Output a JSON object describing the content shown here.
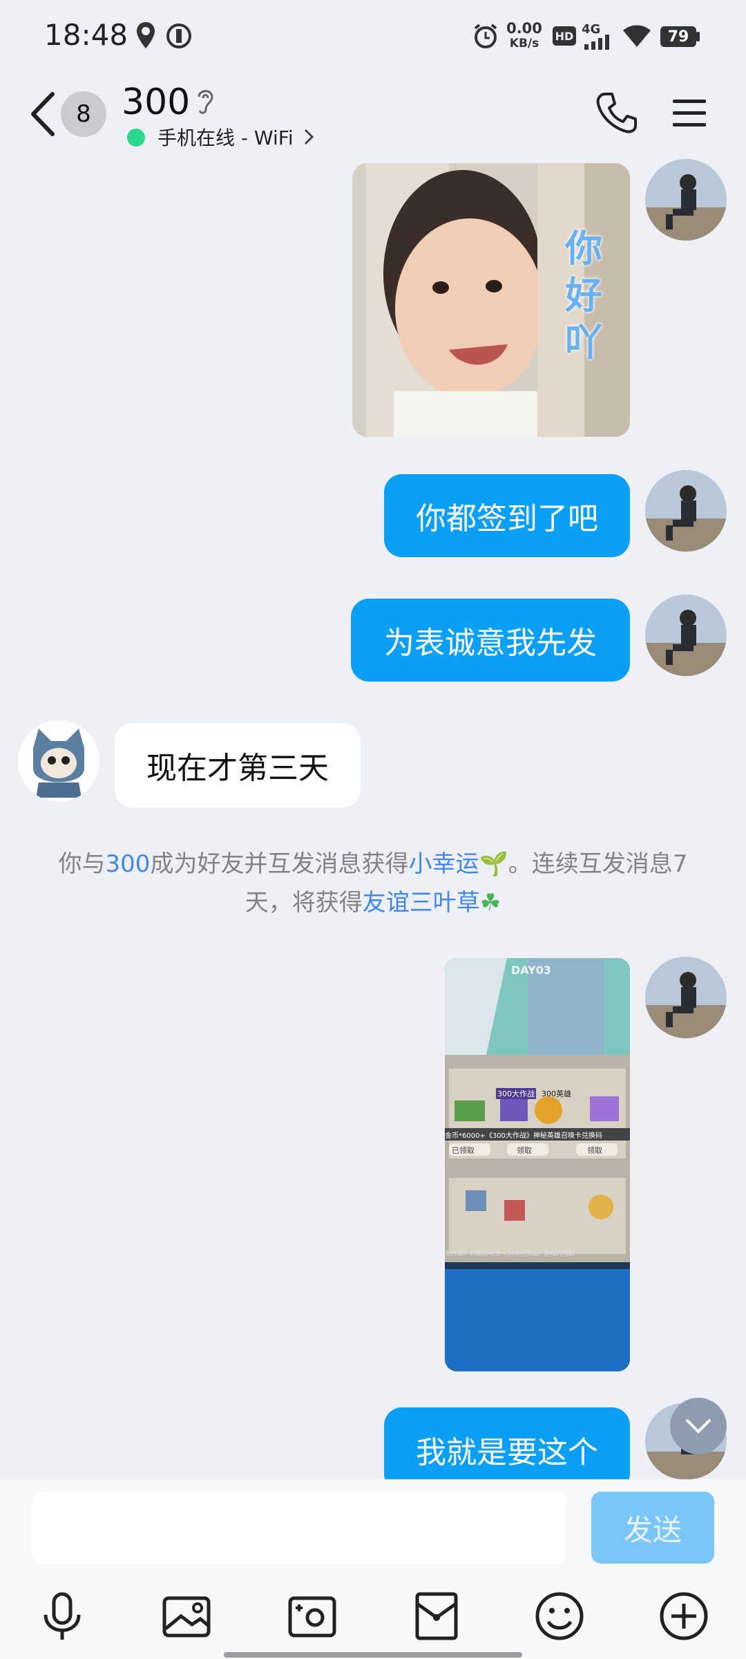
{
  "status_bar": {
    "time": "18:48",
    "net_speed_value": "0.00",
    "net_speed_unit": "KB/s",
    "hd_label": "HD",
    "signal_label": "4G",
    "battery": "79"
  },
  "header": {
    "unread_count": "8",
    "contact_name": "300",
    "online_status": "手机在线 - WiFi"
  },
  "messages": {
    "m1_sticker_text": "你好吖",
    "m2": "你都签到了吧",
    "m3": "为表诚意我先发",
    "m4": "现在才第三天",
    "m6": "我就是要这个"
  },
  "system_message": {
    "p1": "你与",
    "name": "300",
    "p2": "成为好友并互发消息获得",
    "link1": "小幸运",
    "p3": "。连续互发消息7天，将获得",
    "link2": "友谊三叶草"
  },
  "screenshot_texts": {
    "title1": "300大作战",
    "title2": "300英雄",
    "reward_line": "金币*6000+《300大作战》神秘英雄召唤卡兑换码",
    "btn_claimed": "已领取",
    "btn_claim": "领取",
    "btn_claim2": "领取",
    "footer": "大作战》的奖励可至《300大作战》游戏内领取~",
    "day_label": "DAY03"
  },
  "composer": {
    "placeholder": "",
    "send_label": "发送"
  },
  "colors": {
    "accent": "#0ba0f5",
    "link": "#3f86f2",
    "background": "#eef0f5",
    "online": "#2bd88b"
  }
}
